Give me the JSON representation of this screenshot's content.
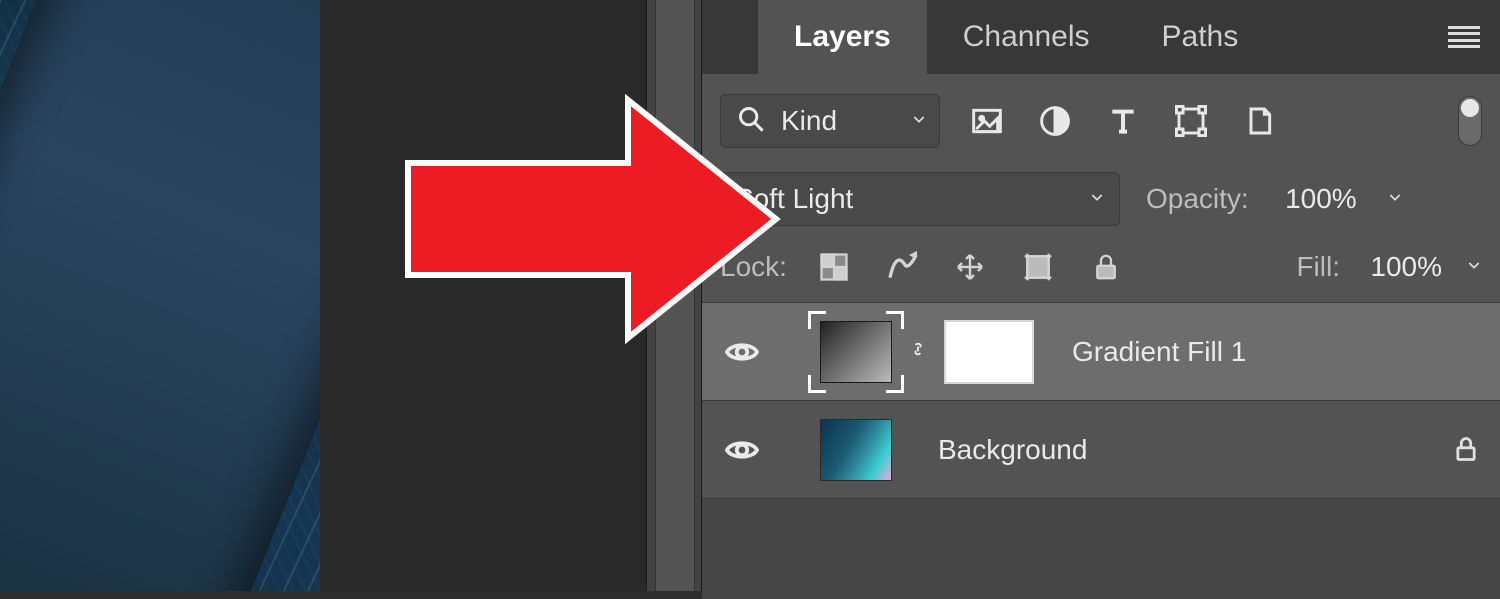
{
  "tabs": {
    "layers": "Layers",
    "channels": "Channels",
    "paths": "Paths"
  },
  "filter": {
    "kind_label": "Kind"
  },
  "blend": {
    "mode": "Soft Light",
    "opacity_label": "Opacity:",
    "opacity_value": "100%"
  },
  "lock": {
    "label": "Lock:",
    "fill_label": "Fill:",
    "fill_value": "100%"
  },
  "layers": [
    {
      "name": "Gradient Fill 1",
      "locked": false
    },
    {
      "name": "Background",
      "locked": true
    }
  ],
  "colors": {
    "panel_bg": "#535353",
    "arrow": "#ed1c24"
  }
}
